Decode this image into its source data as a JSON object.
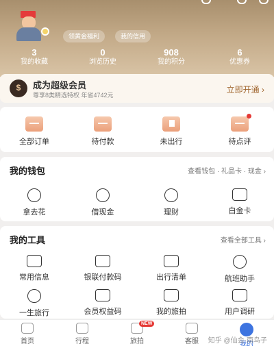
{
  "header": {
    "pills": [
      "领黄金福利",
      "我的信用"
    ],
    "stats": [
      {
        "value": "3",
        "label": "我的收藏"
      },
      {
        "value": "0",
        "label": "浏览历史"
      },
      {
        "value": "908",
        "label": "我的积分"
      },
      {
        "value": "6",
        "label": "优惠券"
      }
    ]
  },
  "vip": {
    "title": "成为超级会员",
    "subtitle": "尊享8类精选特权 年省4742元",
    "action": "立即开通 ›"
  },
  "orders": {
    "items": [
      "全部订单",
      "待付款",
      "未出行",
      "待点评"
    ]
  },
  "wallet": {
    "title": "我的钱包",
    "more": "查看钱包 · 礼品卡 · 现金 ›",
    "items": [
      "拿去花",
      "借现金",
      "理财",
      "白金卡"
    ]
  },
  "tools": {
    "title": "我的工具",
    "more": "查看全部工具 ›",
    "row1": [
      "常用信息",
      "银联付款码",
      "出行清单",
      "航班助手"
    ],
    "row2": [
      "一生旅行",
      "会员权益码",
      "我的旅拍",
      "用户调研"
    ]
  },
  "tabbar": {
    "items": [
      "首页",
      "行程",
      "旅拍",
      "客服",
      "我的"
    ],
    "new_badge": "NEW"
  },
  "watermark": "知乎 @仙会·南鸟子",
  "colors": {
    "accent": "#3d74e0",
    "gold": "#c2a987",
    "vip_link": "#a0652e"
  }
}
